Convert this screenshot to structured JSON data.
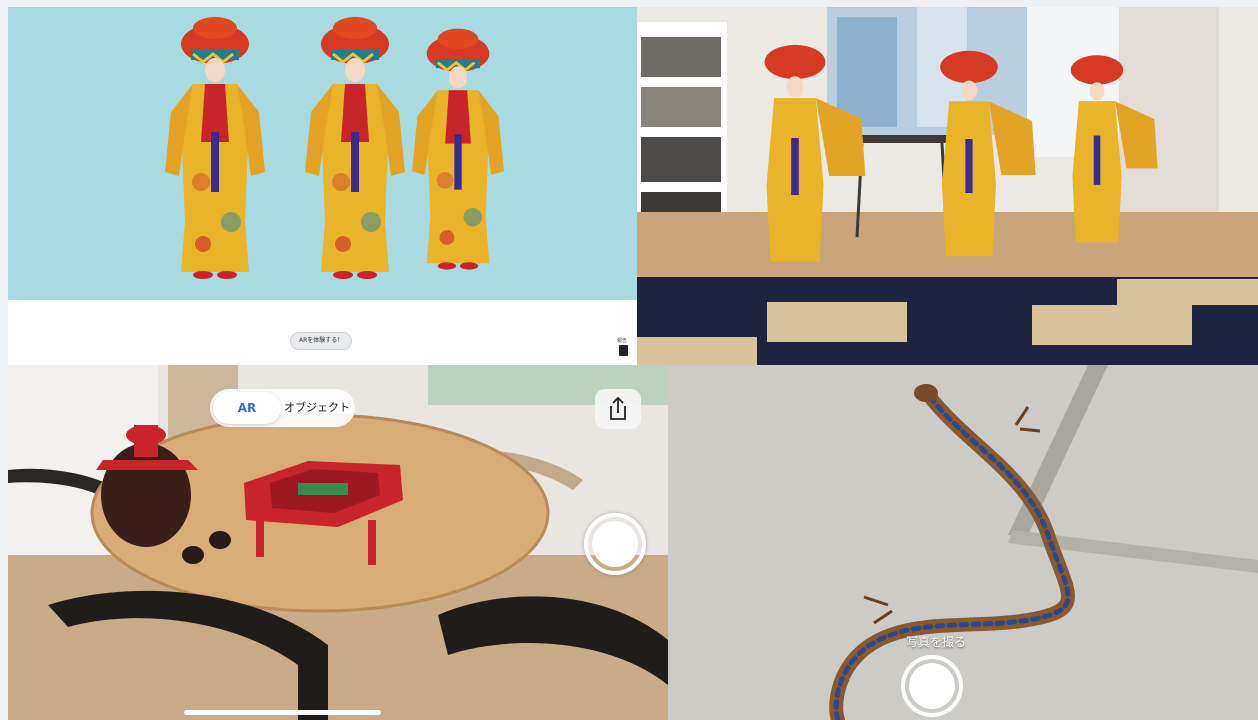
{
  "top_left": {
    "ar_chip_label": "ARを体験する！",
    "corner_label": "報告"
  },
  "bottom_left": {
    "segment": {
      "ar_label": "AR",
      "object_label": "オブジェクト",
      "selected": "AR"
    },
    "share_icon": "share-icon",
    "shutter_icon": "shutter-button"
  },
  "bottom_right": {
    "caption": "写真を撮る",
    "shutter_icon": "shutter-button"
  },
  "colors": {
    "stage_cyan": "#a7dbe1",
    "segment_active_text": "#2f6fd6",
    "costume_yellow": "#e9b32a",
    "hat_red": "#d63a22",
    "lacquer_red": "#c8242a"
  }
}
